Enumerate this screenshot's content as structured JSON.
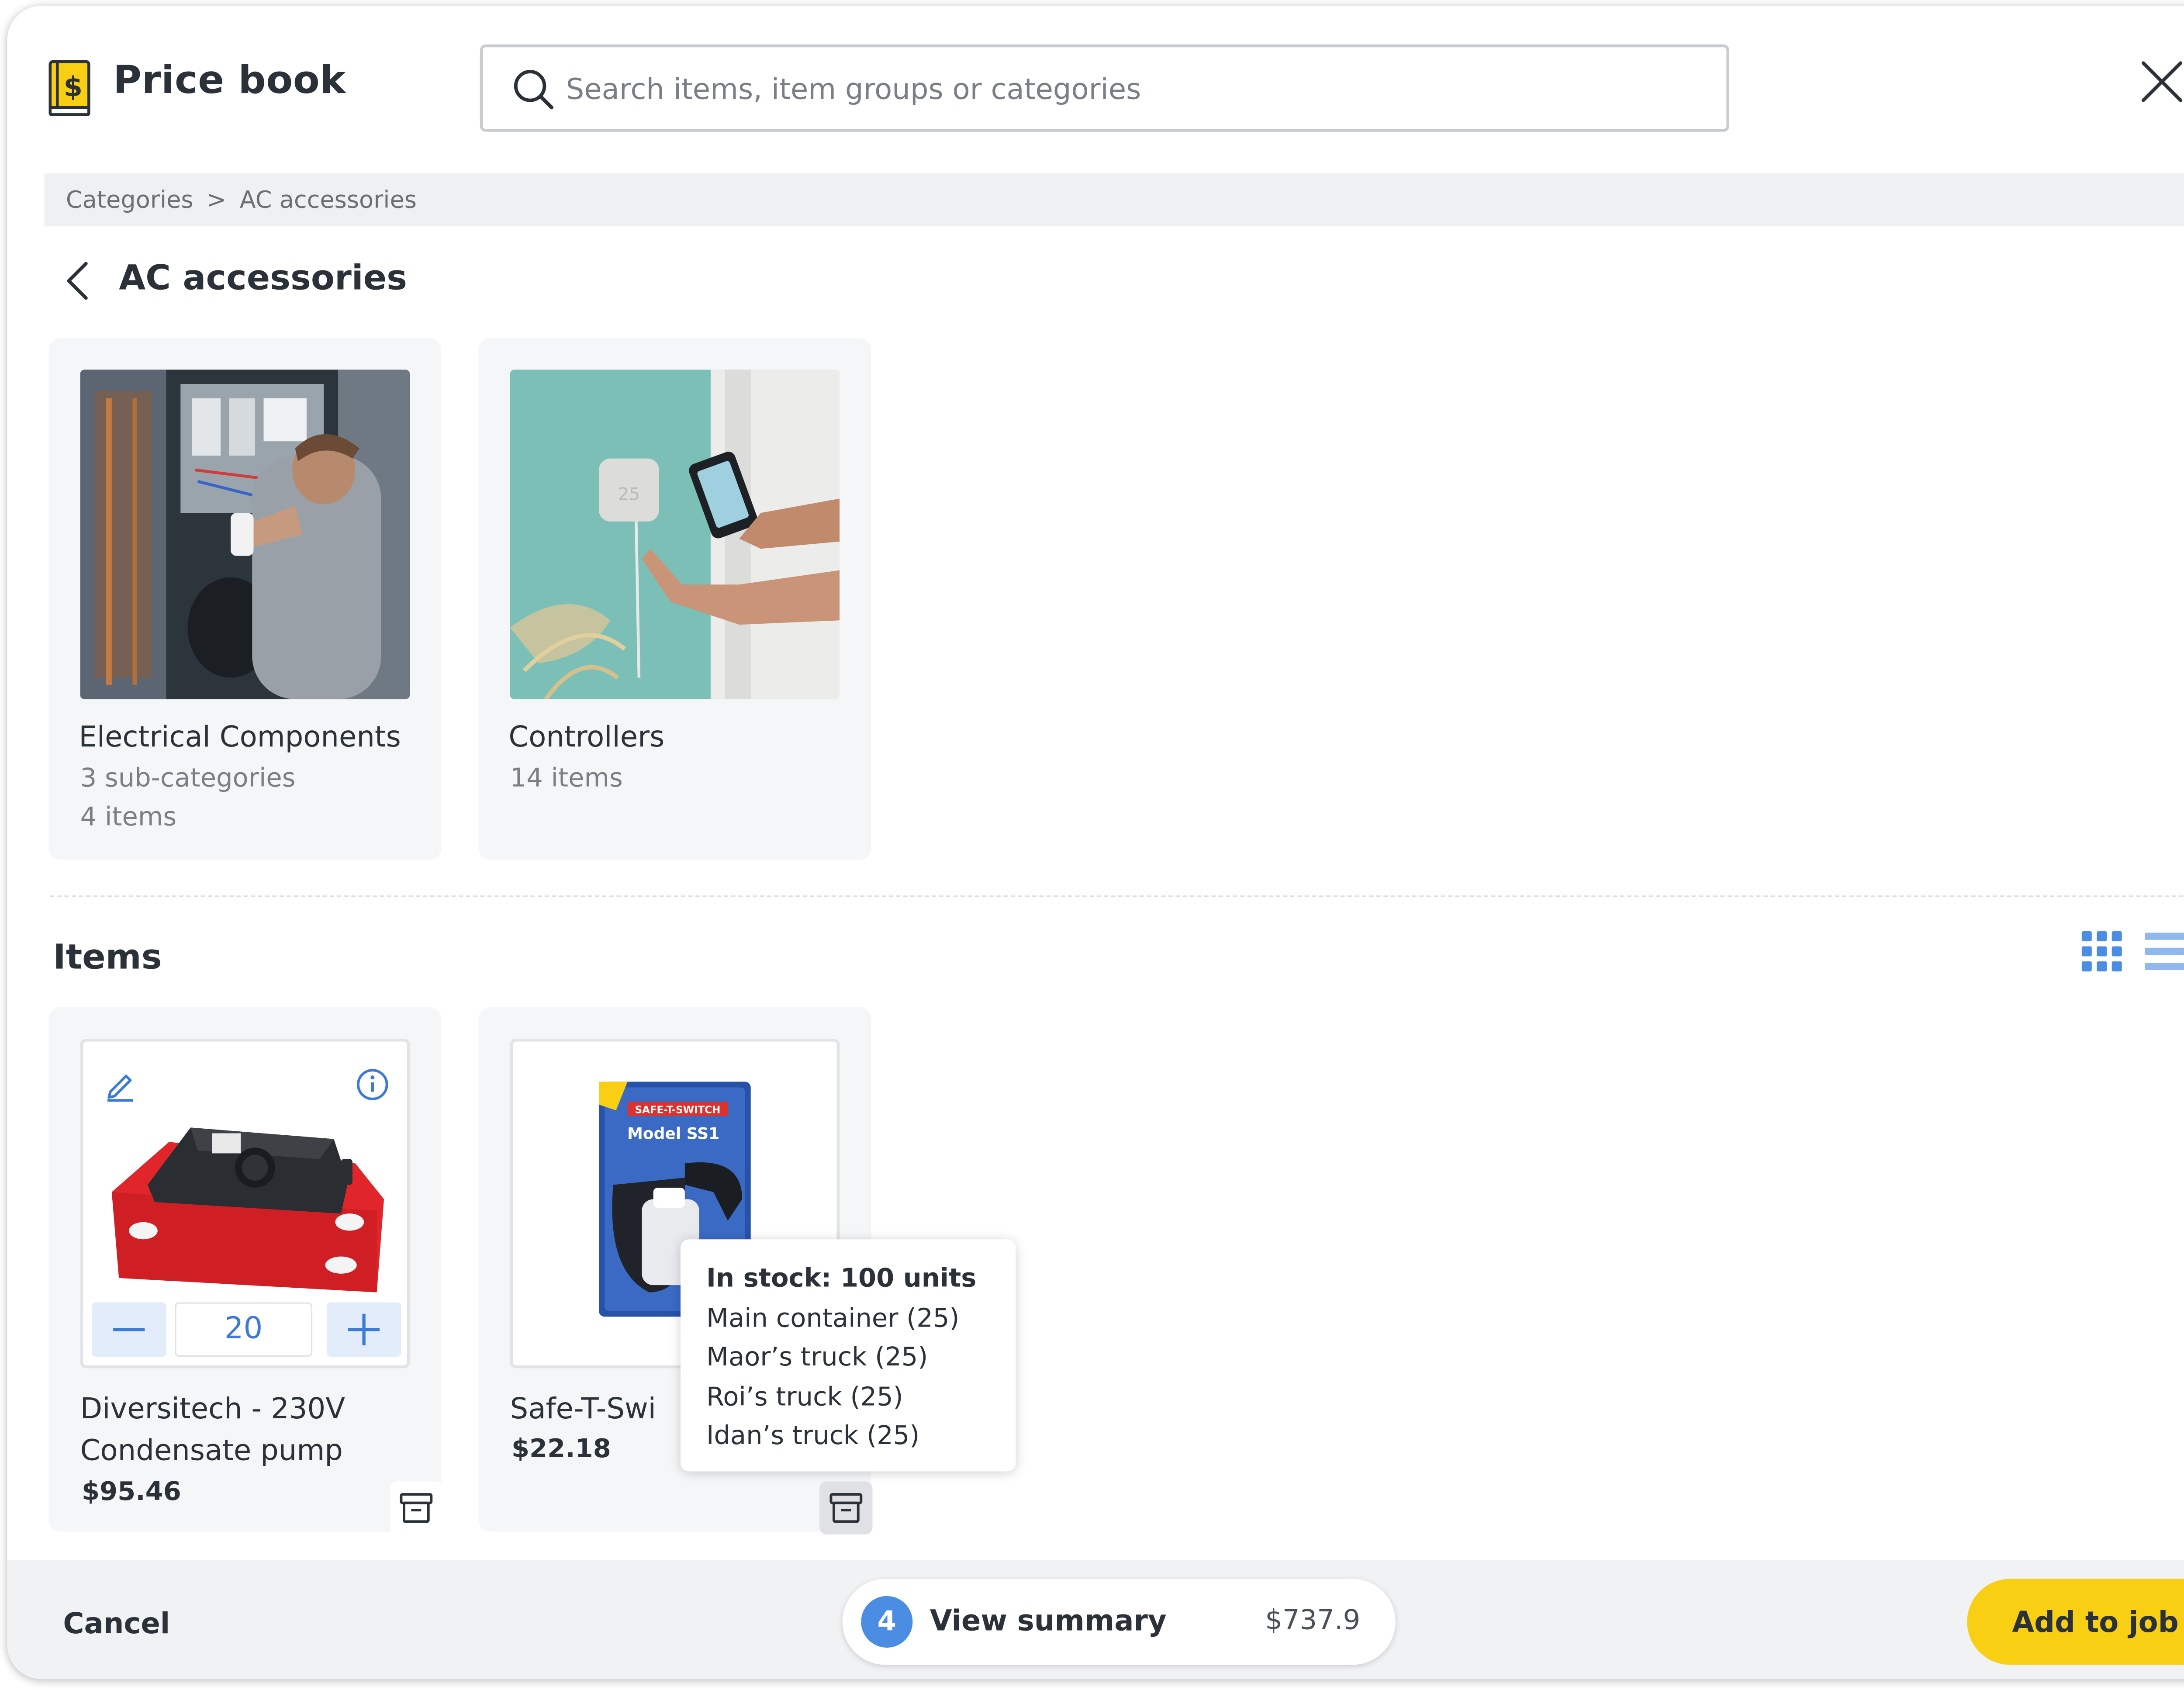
{
  "header": {
    "title": "Price book",
    "logo_icon": "price-book-icon",
    "search_placeholder": "Search items, item groups or categories",
    "search_value": ""
  },
  "breadcrumb": {
    "root": "Categories",
    "separator": ">",
    "current": "AC accessories"
  },
  "section": {
    "title": "AC accessories"
  },
  "categories": [
    {
      "name": "Electrical Components",
      "meta1": "3 sub-categories",
      "meta2": "4 items",
      "image": "technician-wiring-electrical-panel"
    },
    {
      "name": "Controllers",
      "meta1": "14 items",
      "image": "hand-touching-wall-thermostat-with-phone"
    }
  ],
  "items_section": {
    "title": "Items",
    "view_modes": [
      "grid",
      "list"
    ],
    "active_view": "grid"
  },
  "items": [
    {
      "name": "Diversitech - 230V Condensate pump",
      "price": "$95.46",
      "quantity": "20",
      "image": "red-condensate-pump"
    },
    {
      "name": "Safe-T-Swi",
      "price": "$22.18",
      "image": "safe-t-switch-model-ss1-package",
      "package_text": "Model SS1",
      "package_brand": "SAFE-T-SWITCH"
    }
  ],
  "stock_tooltip": {
    "heading": "In stock: 100 units",
    "lines": [
      "Main container (25)",
      "Maor’s truck (25)",
      "Roi’s truck (25)",
      "Idan’s truck (25)"
    ]
  },
  "footer": {
    "cancel_label": "Cancel",
    "summary_count": "4",
    "summary_label": "View summary",
    "summary_total": "$737.9",
    "add_label": "Add to job"
  },
  "colors": {
    "accent_blue": "#4a8de3",
    "primary_yellow": "#f9cf13",
    "text_dark": "#2a3138",
    "muted": "#7a7f85"
  }
}
